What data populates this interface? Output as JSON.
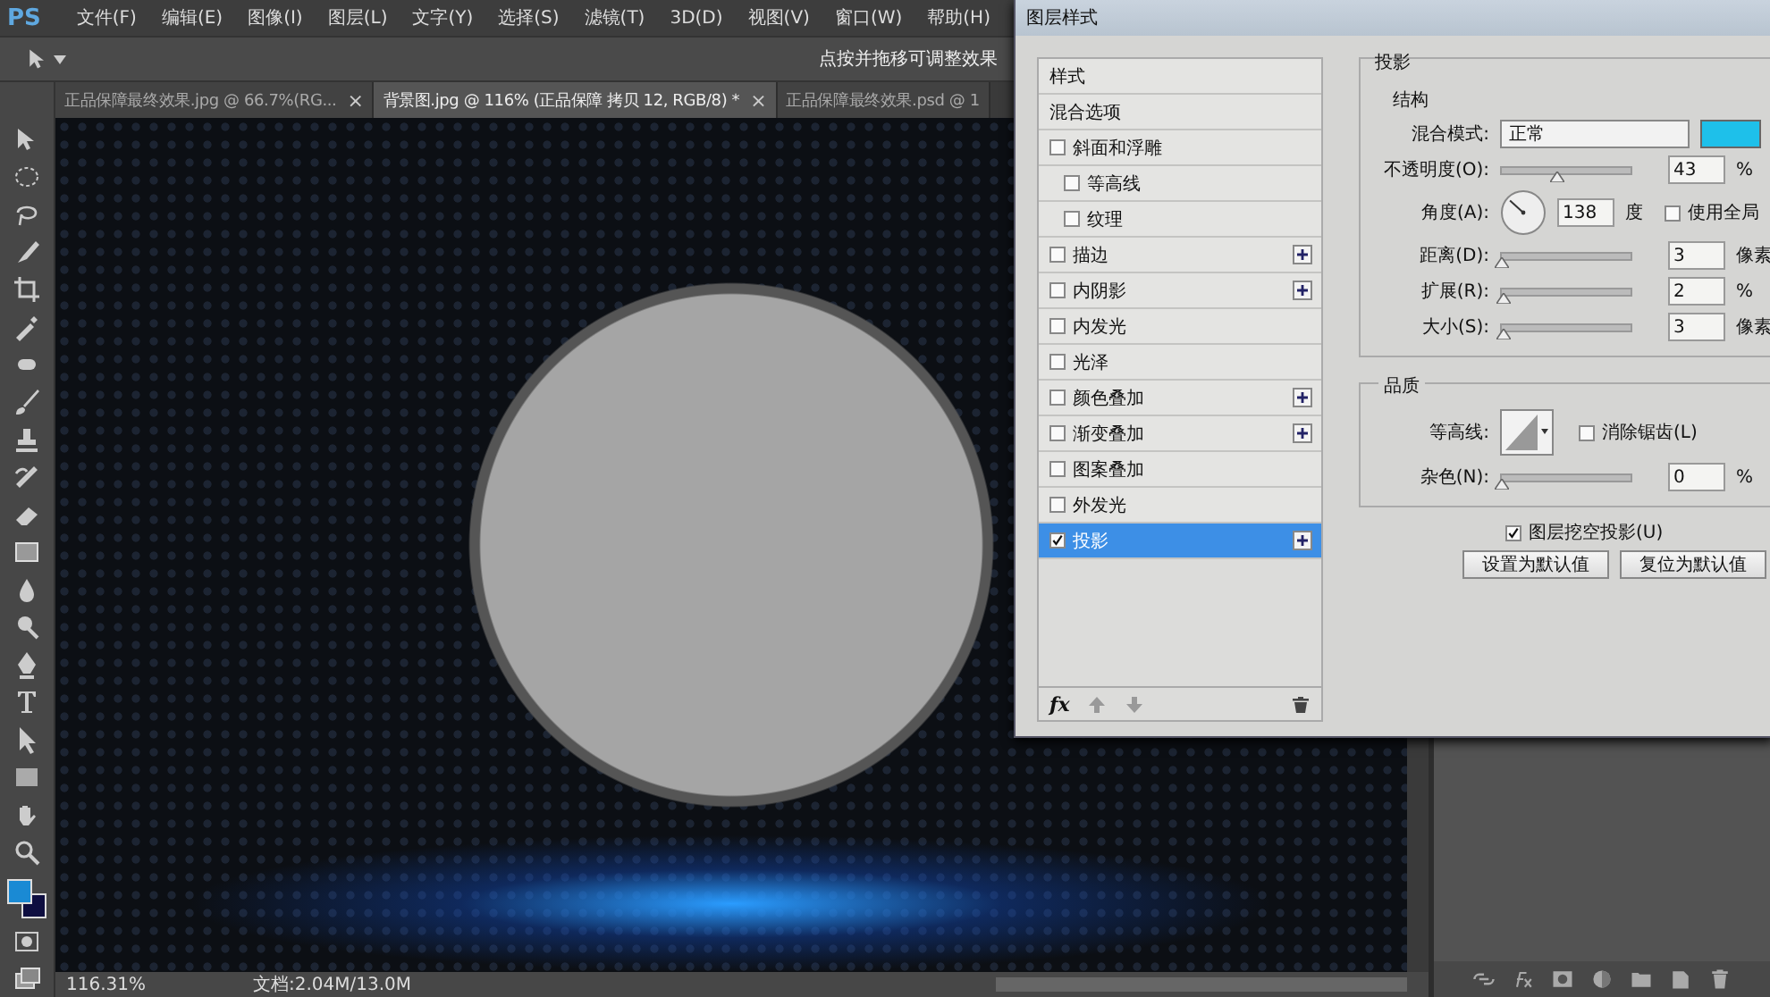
{
  "app": {
    "logo": "PS"
  },
  "menu": [
    "文件(F)",
    "编辑(E)",
    "图像(I)",
    "图层(L)",
    "文字(Y)",
    "选择(S)",
    "滤镜(T)",
    "3D(D)",
    "视图(V)",
    "窗口(W)",
    "帮助(H)"
  ],
  "options_bar": {
    "hint": "点按并拖移可调整效果"
  },
  "doc_tabs": [
    {
      "label": "正品保障最终效果.jpg @ 66.7%(RG...",
      "selected": false,
      "close": "×"
    },
    {
      "label": "背景图.jpg @ 116% (正品保障 拷贝 12, RGB/8) *",
      "selected": true,
      "close": "×"
    },
    {
      "label": "正品保障最终效果.psd @ 1",
      "selected": false
    }
  ],
  "status_bar": {
    "zoom": "116.31%",
    "doc": "文档:2.04M/13.0M"
  },
  "dialog": {
    "title": "图层样式",
    "styles": [
      {
        "label": "样式",
        "kind": "header",
        "selected": false
      },
      {
        "label": "混合选项",
        "kind": "header",
        "selected": false
      },
      {
        "label": "斜面和浮雕",
        "kind": "check",
        "checked": false,
        "selected": false,
        "children": [
          {
            "label": "等高线",
            "kind": "check",
            "checked": false,
            "selected": false
          },
          {
            "label": "纹理",
            "kind": "check",
            "checked": false,
            "selected": false
          }
        ]
      },
      {
        "label": "描边",
        "kind": "check",
        "checked": false,
        "selected": false,
        "addable": true
      },
      {
        "label": "内阴影",
        "kind": "check",
        "checked": false,
        "selected": false,
        "addable": true
      },
      {
        "label": "内发光",
        "kind": "check",
        "checked": false,
        "selected": false
      },
      {
        "label": "光泽",
        "kind": "check",
        "checked": false,
        "selected": false
      },
      {
        "label": "颜色叠加",
        "kind": "check",
        "checked": false,
        "selected": false,
        "addable": true
      },
      {
        "label": "渐变叠加",
        "kind": "check",
        "checked": false,
        "selected": false,
        "addable": true
      },
      {
        "label": "图案叠加",
        "kind": "check",
        "checked": false,
        "selected": false
      },
      {
        "label": "外发光",
        "kind": "check",
        "checked": false,
        "selected": false
      },
      {
        "label": "投影",
        "kind": "check",
        "checked": true,
        "selected": true,
        "addable": true
      }
    ],
    "footer": {
      "fx": "fx"
    },
    "section_title": "投影",
    "group_title": "结构",
    "blend_mode": {
      "label": "混合模式:",
      "value": "正常",
      "color": "#1ec0ea"
    },
    "opacity": {
      "label": "不透明度(O):",
      "level": 0.43,
      "value": "43",
      "unit": "%"
    },
    "angle": {
      "label": "角度(A):",
      "value": "138",
      "unit": "度"
    },
    "global_light": {
      "label": "使用全局",
      "checked": false
    },
    "sliders": [
      {
        "label": "距离(D):",
        "level": 0,
        "value": "3",
        "unit": "像素"
      },
      {
        "label": "扩展(R):",
        "level": 0.02,
        "value": "2",
        "unit": "%"
      },
      {
        "label": "大小(S):",
        "level": 0.01,
        "value": "3",
        "unit": "像素"
      }
    ],
    "quality": {
      "title": "品质",
      "contour_label": "等高线:",
      "anti_alias": {
        "label": "消除锯齿(L)",
        "checked": false
      },
      "noise": {
        "label": "杂色(N):",
        "level": 0,
        "value": "0",
        "unit": "%"
      }
    },
    "knockout": {
      "label": "图层挖空投影(U)",
      "checked": true
    },
    "buttons": [
      "设置为默认值",
      "复位为默认值"
    ]
  }
}
